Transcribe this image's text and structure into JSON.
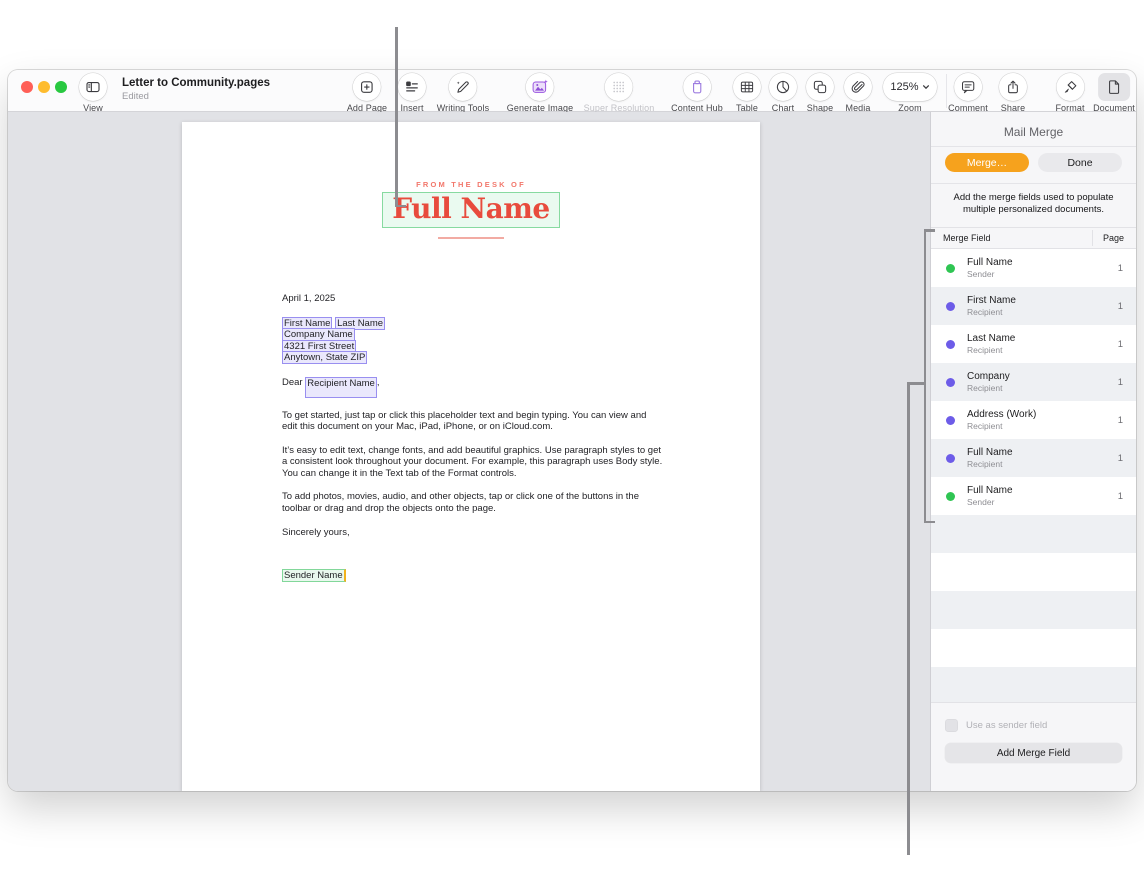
{
  "window": {
    "title": "Letter to Community.pages",
    "status": "Edited"
  },
  "toolbar": {
    "view_label": "View",
    "items": [
      {
        "label": "Add Page"
      },
      {
        "label": "Insert"
      },
      {
        "label": "Writing Tools"
      },
      {
        "label": "Generate Image"
      },
      {
        "label": "Super Resolution",
        "disabled": true
      },
      {
        "label": "Content Hub"
      }
    ],
    "items2": [
      {
        "label": "Table"
      },
      {
        "label": "Chart"
      },
      {
        "label": "Shape"
      },
      {
        "label": "Media"
      }
    ],
    "zoom": {
      "value": "125%",
      "label": "Zoom"
    },
    "right": [
      {
        "label": "Comment"
      },
      {
        "label": "Share"
      },
      {
        "label": "Format"
      },
      {
        "label": "Document",
        "selected": true
      }
    ]
  },
  "letter": {
    "masthead_kicker": "FROM THE DESK OF",
    "masthead_field": "Full Name",
    "date": "April 1, 2025",
    "address_fields": [
      "First Name",
      "Last Name",
      "Company Name",
      "4321 First Street",
      "Anytown, State ZIP"
    ],
    "salutation_prefix": "Dear ",
    "salutation_field": "Recipient Name",
    "salutation_suffix": ",",
    "paragraphs": [
      "To get started, just tap or click this placeholder text and begin typing. You can view and edit this document on your Mac, iPad, iPhone, or on iCloud.com.",
      "It’s easy to edit text, change fonts, and add beautiful graphics. Use paragraph styles to get a consistent look throughout your document. For example, this paragraph uses Body style. You can change it in the Text tab of the Format controls.",
      "To add photos, movies, audio, and other objects, tap or click one of the buttons in the toolbar or drag and drop the objects onto the page."
    ],
    "closing": "Sincerely yours,",
    "signature_field": "Sender Name"
  },
  "sidebar": {
    "title": "Mail Merge",
    "merge_button": "Merge…",
    "done_button": "Done",
    "description": "Add the merge fields used to populate multiple personalized documents.",
    "table_header": {
      "field": "Merge Field",
      "page": "Page"
    },
    "rows": [
      {
        "name": "Full Name",
        "role": "Sender",
        "page": "1",
        "dot_color": "#2fc553"
      },
      {
        "name": "First Name",
        "role": "Recipient",
        "page": "1",
        "dot_color": "#6d5ce8"
      },
      {
        "name": "Last Name",
        "role": "Recipient",
        "page": "1",
        "dot_color": "#6d5ce8"
      },
      {
        "name": "Company",
        "role": "Recipient",
        "page": "1",
        "dot_color": "#6d5ce8"
      },
      {
        "name": "Address (Work)",
        "role": "Recipient",
        "page": "1",
        "dot_color": "#6d5ce8"
      },
      {
        "name": "Full Name",
        "role": "Recipient",
        "page": "1",
        "dot_color": "#6d5ce8"
      },
      {
        "name": "Full Name",
        "role": "Sender",
        "page": "1",
        "dot_color": "#2fc553"
      }
    ],
    "checkbox_label": "Use as sender field",
    "add_button": "Add Merge Field"
  },
  "colors": {
    "accent_orange": "#f6a21d",
    "sender_dot": "#2fc553",
    "recipient_dot": "#6d5ce8",
    "recipient_field_bg": "#eae8fc",
    "recipient_field_border": "#998ff0",
    "sender_field_bg": "#e9f8ee",
    "sender_field_border": "#82d79a",
    "masthead_red": "#e84b3d",
    "callout_gray": "#8c8c90"
  }
}
